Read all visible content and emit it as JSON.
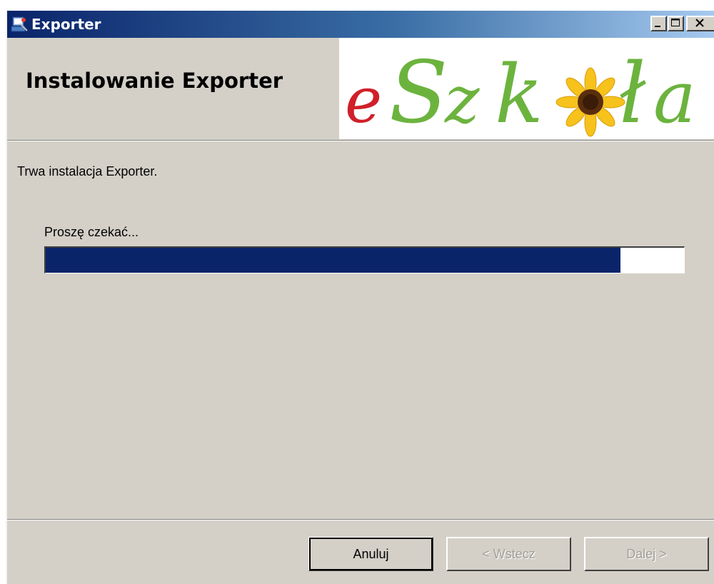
{
  "window": {
    "title": "Exporter",
    "controls": {
      "minimize": "minimize-icon",
      "maximize": "maximize-icon",
      "close": "close-icon"
    }
  },
  "header": {
    "title": "Instalowanie Exporter",
    "logo_text": "eSzkoła"
  },
  "body": {
    "status": "Trwa instalacja Exporter.",
    "progress_label": "Proszę czekać...",
    "progress_fraction": 0.9
  },
  "buttons": {
    "cancel": "Anuluj",
    "back": "< Wstecz",
    "next": "Dalej >"
  },
  "colors": {
    "face": "#d4d0c8",
    "titlebar_start": "#0a246a",
    "titlebar_end": "#a6caf0",
    "progress_fill": "#0a246a",
    "logo_red": "#d0202a",
    "logo_green": "#6cb33e",
    "sunflower": "#f6c21b"
  }
}
